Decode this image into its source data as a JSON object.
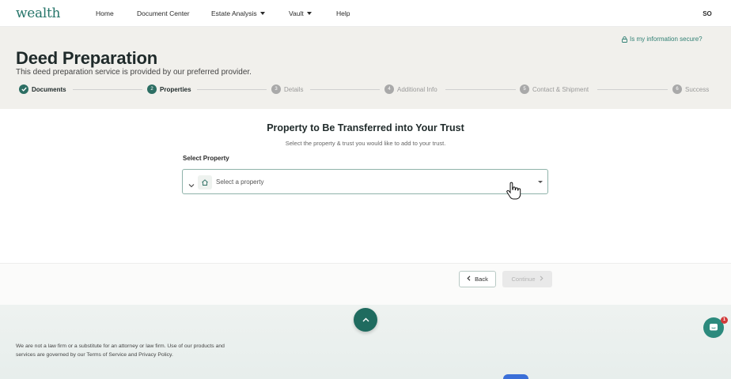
{
  "app": {
    "logo": "wealth",
    "nav": [
      {
        "label": "Home"
      },
      {
        "label": "Document Center"
      },
      {
        "label": "Estate Analysis"
      },
      {
        "label": "Vault"
      },
      {
        "label": "Help"
      }
    ],
    "user_initials": "SO"
  },
  "header": {
    "secure_link": "Is my information secure?",
    "title": "Deed Preparation",
    "subtitle": "This deed preparation service is provided by our preferred provider."
  },
  "stepper": {
    "steps": [
      {
        "label": "Documents",
        "number": "1",
        "state": "done"
      },
      {
        "label": "Properties",
        "number": "2",
        "state": "active"
      },
      {
        "label": "Details",
        "number": "3",
        "state": "pending"
      },
      {
        "label": "Additional Info",
        "number": "4",
        "state": "pending"
      },
      {
        "label": "Contact & Shipment",
        "number": "5",
        "state": "pending"
      },
      {
        "label": "Success",
        "number": "6",
        "state": "pending"
      }
    ]
  },
  "main": {
    "title": "Property to Be Transferred into Your Trust",
    "description": "Select the property & trust you would like to add to your trust.",
    "select_label": "Select Property",
    "select_placeholder": "Select a property"
  },
  "actions": {
    "back_label": "Back",
    "continue_label": "Continue"
  },
  "footer": {
    "disclaimer": "We are not a law firm or a substitute for an attorney or law firm. Use of our products and services are governed by our Terms of Service and Privacy Policy.",
    "chat_badge": "1"
  },
  "colors": {
    "brand": "#26756a",
    "header_bg": "#f1f0ec",
    "primary_dark": "#1f6b5f",
    "badge": "#d23a3a"
  }
}
